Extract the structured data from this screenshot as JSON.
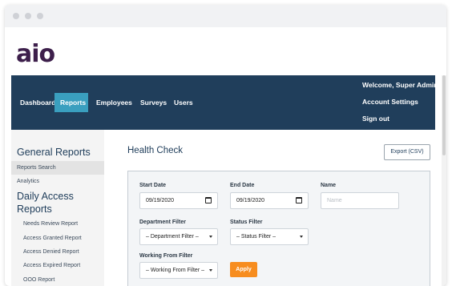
{
  "brand": {
    "logo_text": "aio"
  },
  "nav": {
    "items": [
      {
        "label": "Dashboard"
      },
      {
        "label": "Reports",
        "active": true
      },
      {
        "label": "Employees"
      },
      {
        "label": "Surveys"
      },
      {
        "label": "Users"
      }
    ],
    "welcome": "Welcome, Super Admin",
    "account_settings": "Account Settings",
    "sign_out": "Sign out"
  },
  "sidebar": {
    "general_heading": "General Reports",
    "general_items": [
      {
        "label": "Reports Search",
        "active": true
      },
      {
        "label": "Analytics"
      }
    ],
    "daily_heading_line1": "Daily Access",
    "daily_heading_line2": "Reports",
    "daily_items": [
      {
        "label": "Needs Review Report"
      },
      {
        "label": "Access Granted Report"
      },
      {
        "label": "Access Denied Report"
      },
      {
        "label": "Access Expired Report"
      },
      {
        "label": "OOO Report"
      }
    ]
  },
  "main": {
    "title": "Health Check",
    "export_label": "Export (CSV)",
    "filters": {
      "start_date_label": "Start Date",
      "start_date_value": "09/19/2020",
      "end_date_label": "End Date",
      "end_date_value": "09/19/2020",
      "name_label": "Name",
      "name_placeholder": "Name",
      "department_label": "Department Filter",
      "department_value": "– Department Filter –",
      "status_label": "Status Filter",
      "status_value": "– Status Filter –",
      "working_from_label": "Working From Filter",
      "working_from_value": "– Working From Filter –",
      "apply_label": "Apply"
    }
  },
  "colors": {
    "navbar": "#203e5b",
    "nav_active": "#3a9fbf",
    "brand": "#3d1f4b",
    "apply": "#f78d1f"
  },
  "icons": [
    "calendar-icon",
    "chevron-down-icon"
  ]
}
